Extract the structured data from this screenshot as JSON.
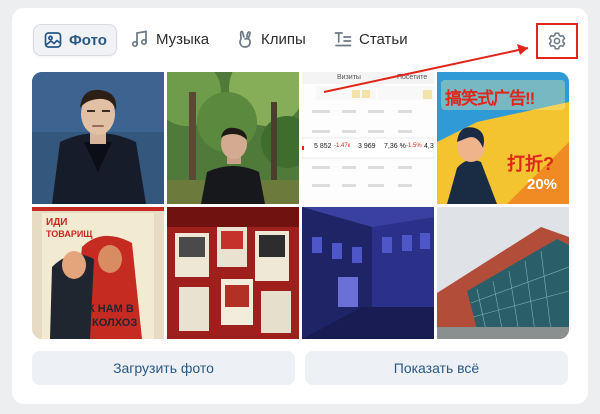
{
  "tabs": [
    {
      "label": "Фото",
      "icon": "image-icon",
      "active": true
    },
    {
      "label": "Музыка",
      "icon": "music-note-icon",
      "active": false
    },
    {
      "label": "Клипы",
      "icon": "clips-hand-icon",
      "active": false
    },
    {
      "label": "Статьи",
      "icon": "article-icon",
      "active": false
    }
  ],
  "settings_icon": "gear-icon",
  "photos": [
    {
      "name": "photo-man-dark-coat"
    },
    {
      "name": "photo-man-forest"
    },
    {
      "name": "photo-stats-screenshot"
    },
    {
      "name": "photo-chinese-poster"
    },
    {
      "name": "photo-soviet-poster"
    },
    {
      "name": "photo-museum-wall"
    },
    {
      "name": "photo-night-street"
    },
    {
      "name": "photo-glass-building"
    }
  ],
  "stats_shot": {
    "col1": "Визиты",
    "col2": "Посетите",
    "row_values": [
      "5 852",
      "-1.47к",
      "3 969",
      "7,36 %",
      "-1.5%",
      "4,3"
    ]
  },
  "poster_cn": {
    "title": "搞笑式广告!!",
    "bottom": "打折?",
    "percent": "20%"
  },
  "poster_su": {
    "top": "ИДИ",
    "top2": "ТОВАРИЩ",
    "bottom1": "К НАМ В",
    "bottom2": "КОЛХОЗ"
  },
  "buttons": {
    "upload": "Загрузить фото",
    "show_all": "Показать всё"
  },
  "colors": {
    "accent": "#2a5885",
    "highlight": "#e0261b",
    "button_bg": "#edf0f5"
  }
}
